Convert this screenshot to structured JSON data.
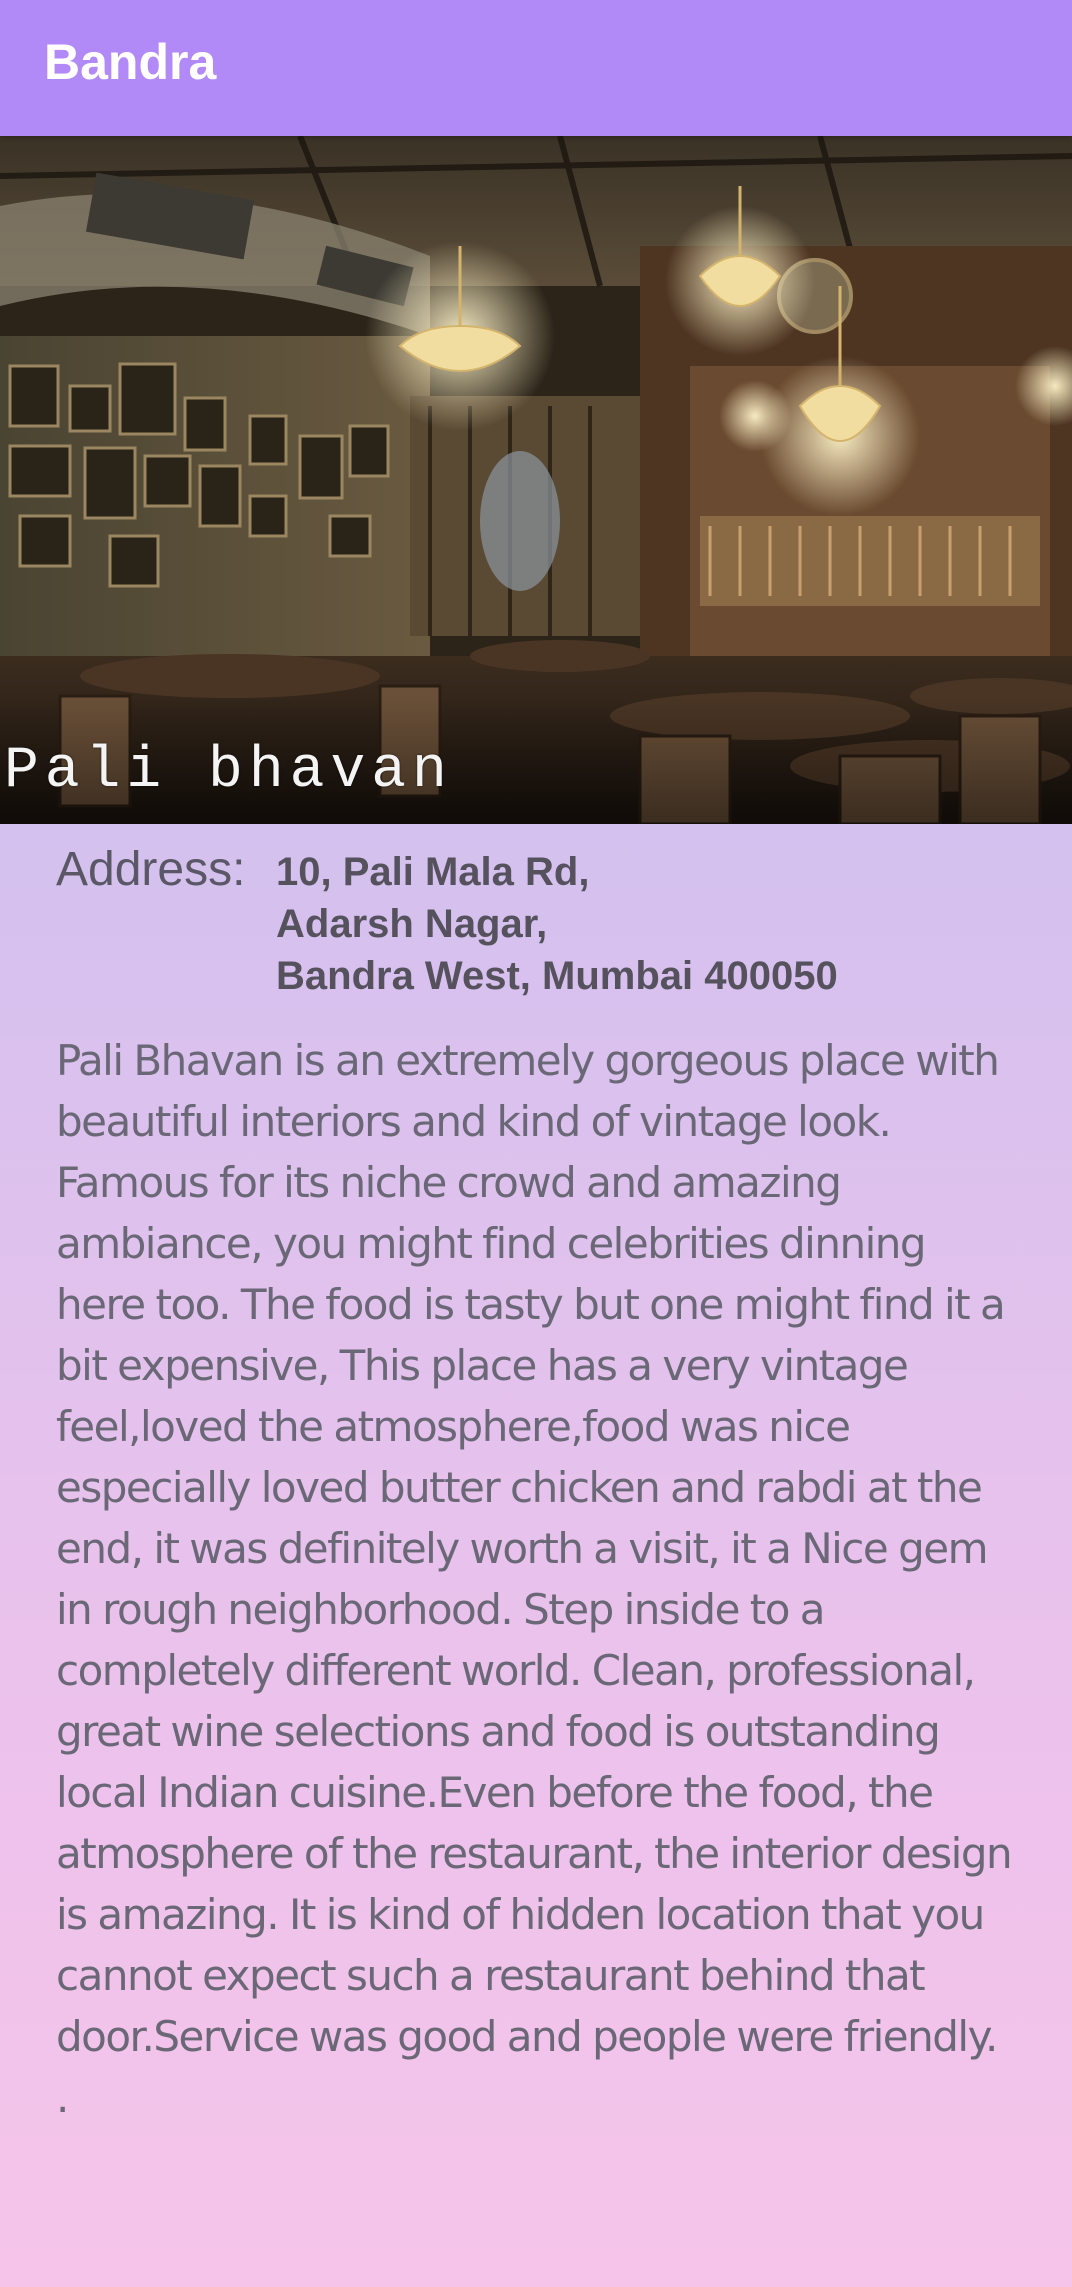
{
  "app_bar": {
    "title": "Bandra"
  },
  "restaurant": {
    "name": "Pali bhavan",
    "address_label": "Address:",
    "address_lines": [
      "10, Pali Mala Rd,",
      "Adarsh Nagar,",
      "Bandra West, Mumbai 400050"
    ],
    "description": "Pali Bhavan is an extremely gorgeous place with beautiful interiors and kind of vintage look. Famous for its niche crowd and amazing ambiance, you might find celebrities dinning here too. The food is tasty but one might find it a bit expensive, This place has a very vintage feel,loved the atmosphere,food was nice especially loved butter chicken and rabdi at the end, it was definitely worth a visit, it a Nice gem in rough neighborhood. Step inside to a completely different world. Clean, professional, great wine selections and food is outstanding local Indian cuisine.Even before the food, the atmosphere of the restaurant, the interior design is amazing. It is kind of hidden location that you cannot expect such a restaurant behind that door.Service was good and people were friendly. ."
  },
  "colors": {
    "app_bar": "#b28af8",
    "background_top": "#bdbdee",
    "background_bottom": "#f6c4ea",
    "text_muted": "#6a6876"
  }
}
